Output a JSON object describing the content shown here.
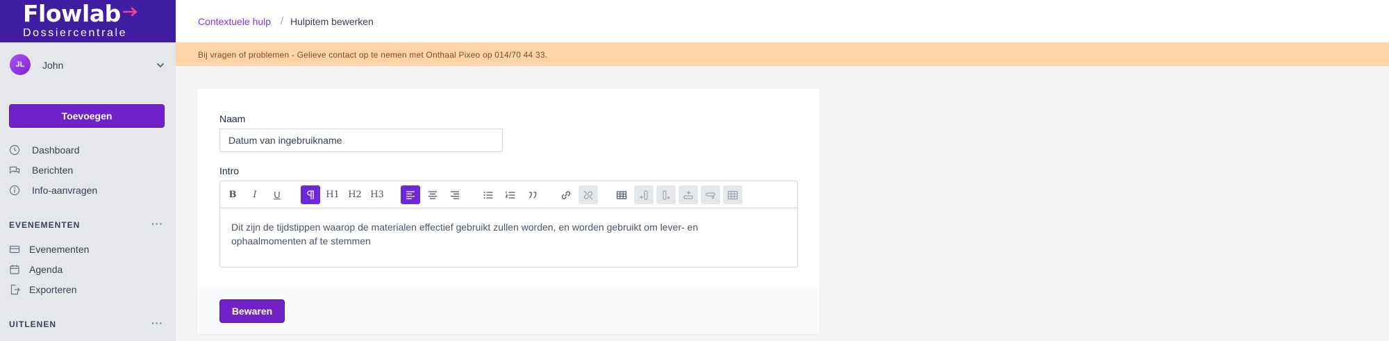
{
  "brand": {
    "name": "Flowlab",
    "subtitle": "Dossiercentrale"
  },
  "user": {
    "initials": "JL",
    "name": "John"
  },
  "sidebar": {
    "add_label": "Toevoegen",
    "items": [
      {
        "label": "Dashboard",
        "icon": "dashboard-icon"
      },
      {
        "label": "Berichten",
        "icon": "chat-icon"
      },
      {
        "label": "Info-aanvragen",
        "icon": "info-icon"
      }
    ],
    "sections": [
      {
        "title": "EVENEMENTEN",
        "more": "···",
        "items": [
          {
            "label": "Evenementen",
            "icon": "ticket-icon"
          },
          {
            "label": "Agenda",
            "icon": "calendar-icon"
          },
          {
            "label": "Exporteren",
            "icon": "export-icon"
          }
        ]
      },
      {
        "title": "UITLENEN",
        "more": "···"
      }
    ]
  },
  "breadcrumb": {
    "parent": "Contextuele hulp",
    "separator": "/",
    "current": "Hulpitem bewerken"
  },
  "banner": {
    "text": "Bij vragen of problemen - Gelieve contact op te nemen met Onthaal Pixeo op 014/70 44 33."
  },
  "form": {
    "name_label": "Naam",
    "name_value": "Datum van ingebruikname",
    "intro_label": "Intro",
    "intro_text": "Dit zijn de tijdstippen waarop de materialen effectief gebruikt zullen worden, en worden gebruikt om lever- en ophaalmomenten af te stemmen",
    "save_label": "Bewaren"
  },
  "toolbar": {
    "h1": "H1",
    "h2": "H2",
    "h3": "H3",
    "bold": "B",
    "italic": "I",
    "underline": "U"
  },
  "colors": {
    "brand": "#3f1ca0",
    "accent": "#7022c8",
    "banner": "#fdd5a8",
    "link": "#7c3aed"
  }
}
